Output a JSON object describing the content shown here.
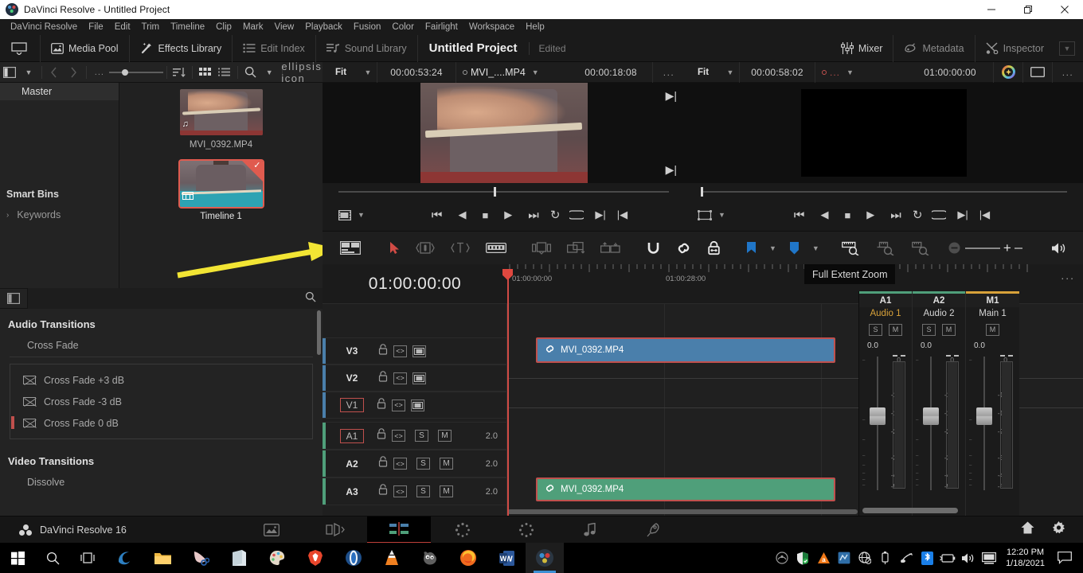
{
  "window": {
    "title": "DaVinci Resolve - Untitled Project",
    "app_icon": "resolve-logo-icon",
    "minimize": "minimize-icon",
    "maximize": "restore-icon",
    "close": "close-icon"
  },
  "menubar": {
    "items": [
      "DaVinci Resolve",
      "File",
      "Edit",
      "Trim",
      "Timeline",
      "Clip",
      "Mark",
      "View",
      "Playback",
      "Fusion",
      "Color",
      "Fairlight",
      "Workspace",
      "Help"
    ]
  },
  "toolbar": {
    "home_icon": "home-panel-icon",
    "media_pool": "Media Pool",
    "effects_library": "Effects Library",
    "edit_index": "Edit Index",
    "sound_library": "Sound Library",
    "project_title": "Untitled Project",
    "project_state": "Edited",
    "mixer": "Mixer",
    "metadata": "Metadata",
    "inspector": "Inspector"
  },
  "mediapool_header": {
    "sidebar_toggle": "panel-toggle-icon",
    "dropdown": "chevron-down-icon",
    "back": "chevron-left-icon",
    "forward": "chevron-right-icon",
    "more": "...",
    "sort": "sort-icon",
    "thumbnail_view": "grid-view-icon",
    "list_view": "list-view-icon",
    "search": "search-icon",
    "options": "ellipsis-icon"
  },
  "mediapool": {
    "master": "Master",
    "smart_bins": "Smart Bins",
    "keywords": "Keywords",
    "items": [
      {
        "label": "MVI_0392.MP4",
        "selected": false,
        "badge": "audio-note-icon"
      },
      {
        "label": "Timeline 1",
        "selected": true,
        "badge": "timeline-icon"
      }
    ]
  },
  "source_viewer": {
    "zoom": "Fit",
    "duration": "00:00:53:24",
    "clip_name": "MVI_....MP4",
    "timecode": "00:00:18:08",
    "options": "...",
    "frame_mode_icon": "frame-icon"
  },
  "timeline_viewer": {
    "zoom": "Fit",
    "duration": "00:00:58:02",
    "clip_name": "...",
    "timecode": "01:00:00:00",
    "color_icon": "color-wheel-icon",
    "safe_area_icon": "safe-area-icon",
    "options": "..."
  },
  "transport": {
    "buttons": [
      "jump-to-start-icon",
      "play-reverse-icon",
      "stop-icon",
      "play-icon",
      "jump-to-end-icon",
      "loop-icon",
      "loop-range-icon",
      "next-edit-icon",
      "prev-edit-icon"
    ]
  },
  "timeline_toolbar": {
    "tools": [
      "toolbar-toggle-icon",
      "selection-mode-icon",
      "trim-edit-mode-icon",
      "dynamic-trim-mode-icon",
      "razor-edit-icon",
      "insert-clip-icon",
      "overwrite-clip-icon",
      "replace-clip-icon",
      "snapping-icon",
      "linked-selection-icon",
      "position-lock-icon",
      "flag-icon",
      "marker-icon",
      "full-extent-zoom-icon",
      "detail-zoom-icon",
      "custom-zoom-icon",
      "zoom-out-icon",
      "zoom-in-icon",
      "audio-level-icon",
      "timeline-view-options-icon"
    ]
  },
  "tooltip": {
    "text": "Full Extent Zoom"
  },
  "timeline": {
    "current_timecode": "01:00:00:00",
    "ruler_marks": [
      "01:00:00:00",
      "01:00:28:00"
    ],
    "mixer_label": "Mixer",
    "options": "...",
    "video_tracks": [
      {
        "name": "V3",
        "selected": false,
        "lock": "lock-icon",
        "auto_select": "auto-select-icon",
        "thumb": "track-thumbnail-icon"
      },
      {
        "name": "V2",
        "selected": false,
        "lock": "lock-icon",
        "auto_select": "auto-select-icon",
        "thumb": "track-thumbnail-icon"
      },
      {
        "name": "V1",
        "selected": true,
        "lock": "lock-icon",
        "auto_select": "auto-select-icon",
        "thumb": "track-thumbnail-icon"
      }
    ],
    "audio_tracks": [
      {
        "name": "A1",
        "selected": true,
        "solo": "S",
        "mute": "M",
        "channels": "2.0"
      },
      {
        "name": "A2",
        "selected": false,
        "solo": "S",
        "mute": "M",
        "channels": "2.0"
      },
      {
        "name": "A3",
        "selected": false,
        "solo": "S",
        "mute": "M",
        "channels": "2.0"
      }
    ],
    "clips": [
      {
        "track": "V3",
        "label": "MVI_0392.MP4",
        "type": "video",
        "link_icon": "link-icon"
      },
      {
        "track": "A3",
        "label": "MVI_0392.MP4",
        "type": "audio",
        "link_icon": "link-icon"
      }
    ]
  },
  "mixer": {
    "strips": [
      {
        "id": "A1",
        "name": "Audio 1",
        "gain": "0.0",
        "solo": "S",
        "mute": "M",
        "color": "#4f9f7a",
        "highlight": true
      },
      {
        "id": "A2",
        "name": "Audio 2",
        "gain": "0.0",
        "solo": "S",
        "mute": "M",
        "color": "#4f9f7a",
        "highlight": false
      },
      {
        "id": "M1",
        "name": "Main 1",
        "gain": "0.0",
        "solo": null,
        "mute": "M",
        "color": "#d8a23a",
        "highlight": false
      }
    ],
    "scale": [
      "0",
      "-5",
      "-10",
      "-15",
      "-20",
      "-30",
      "-40",
      "-50"
    ]
  },
  "pagebar": {
    "brand": "DaVinci Resolve 16",
    "pages": [
      {
        "name": "media-page",
        "icon": "media-icon",
        "active": false
      },
      {
        "name": "cut-page",
        "icon": "cut-icon",
        "active": false
      },
      {
        "name": "edit-page",
        "icon": "edit-icon",
        "active": true
      },
      {
        "name": "fusion-page",
        "icon": "fusion-icon",
        "active": false
      },
      {
        "name": "color-page",
        "icon": "color-icon",
        "active": false
      },
      {
        "name": "fairlight-page",
        "icon": "fairlight-icon",
        "active": false
      },
      {
        "name": "deliver-page",
        "icon": "deliver-icon",
        "active": false
      }
    ],
    "home": "home-icon",
    "settings": "gear-icon"
  },
  "taskbar": {
    "start": "windows-start-icon",
    "search": "search-icon",
    "taskview": "task-view-icon",
    "apps": [
      "edge-dev-icon",
      "file-explorer-icon",
      "scissors-icon",
      "store-icon",
      "paint-icon",
      "brave-icon",
      "opera-icon",
      "vlc-icon",
      "gimp-icon",
      "firefox-icon",
      "word-icon",
      "davinci-resolve-icon"
    ],
    "tray": [
      "hidden-icons-icon",
      "security-icon",
      "avast-icon",
      "intel-graphics-icon",
      "network-offline-icon",
      "usb-icon",
      "audio-device-icon",
      "bluetooth-icon",
      "battery-icon",
      "volume-icon",
      "display-icon"
    ],
    "time": "12:20 PM",
    "date": "1/18/2021",
    "notifications": "notification-icon"
  },
  "effects_library": {
    "search_placeholder": "",
    "sidebar_toggle": "panel-toggle-icon",
    "search_icon": "search-icon",
    "sections": [
      {
        "title": "Audio Transitions",
        "subsection": "Cross Fade",
        "items": [
          {
            "label": "Cross Fade +3 dB",
            "selected": false
          },
          {
            "label": "Cross Fade -3 dB",
            "selected": false
          },
          {
            "label": "Cross Fade 0 dB",
            "selected": true
          }
        ]
      },
      {
        "title": "Video Transitions",
        "subsection": "Dissolve",
        "items": []
      }
    ]
  },
  "colors": {
    "accent_red": "#c0504d",
    "video_clip": "#4a7fab",
    "audio_clip": "#4f9f7a",
    "main_bus": "#d8a23a",
    "annotation_arrow": "#f2e534",
    "panel_bg": "#232323"
  }
}
